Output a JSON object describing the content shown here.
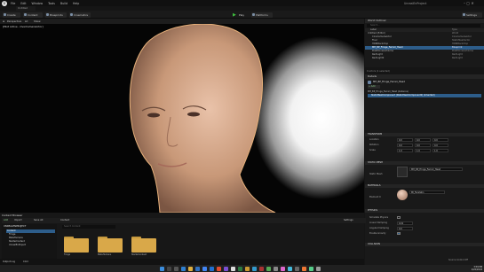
{
  "menu": {
    "items": [
      "File",
      "Edit",
      "Window",
      "Tools",
      "Build",
      "Help"
    ],
    "project": "UnrealEnProject"
  },
  "doc_tab": "Untitled",
  "toolbar": {
    "create": "Create",
    "content": "Content",
    "blueprint": "Blueprints",
    "cinematics": "Cinematics",
    "play": "Play",
    "platforms": "Platforms",
    "settings": "Settings"
  },
  "viewport": {
    "perspective": "Perspective",
    "lit": "Lit",
    "show": "Show",
    "pilot": "[Pilot Active - OverCameraActor]"
  },
  "outliner": {
    "title": "World Outliner",
    "search_placeholder": "Search...",
    "col_label": "Label",
    "col_type": "Type",
    "rows": [
      {
        "name": "Untitled (Editor)",
        "type": "World"
      },
      {
        "name": "CineCameraActor",
        "type": "CineCameraActor"
      },
      {
        "name": "Floor",
        "type": "StaticMeshActor"
      },
      {
        "name": "HDRIBackdrop",
        "type": "HDRIBackdrop"
      },
      {
        "name": "MH_BP_Fringe_Ferrari_Head",
        "type": "Blueprint"
      },
      {
        "name": "PostProcessVolume",
        "type": "PostProcessVolume"
      },
      {
        "name": "RectLight",
        "type": "RectLight"
      },
      {
        "name": "RectLight2",
        "type": "RectLight"
      }
    ],
    "status": "9 actors (1 selected)"
  },
  "details": {
    "title": "Details",
    "actor": "MH_BP_Fringe_Ferrari_Head",
    "add_button": "+ Add",
    "component_root": "MH_BP_Fringe_Ferrari_Head (Instance)",
    "component_child": "StaticMeshComponent (StaticMeshComponent0) (Inherited)",
    "transform": {
      "section": "TRANSFORM",
      "location_label": "Location",
      "rotation_label": "Rotation",
      "scale_label": "Scale",
      "location": [
        "0.0",
        "0.0",
        "0.0"
      ],
      "rotation": [
        "0.0",
        "0.0",
        "0.0"
      ],
      "scale": [
        "1.0",
        "1.0",
        "1.0"
      ]
    },
    "static_mesh": {
      "section": "STATIC MESH",
      "label": "Static Mesh",
      "value": "MH_BP_Fringe_Ferrari_Head"
    },
    "materials": {
      "section": "MATERIALS",
      "label": "Element 0",
      "value": "MI_FaceSkin"
    },
    "physics": {
      "section": "PHYSICS"
    },
    "lighting_fields": [
      {
        "label": "Simulate Physics",
        "value": ""
      },
      {
        "label": "Linear Damping",
        "value": "0.01"
      },
      {
        "label": "Angular Damping",
        "value": "0.0"
      },
      {
        "label": "Enable Gravity",
        "value": ""
      }
    ],
    "collision": {
      "section": "COLLISION"
    }
  },
  "content_browser": {
    "tab": "Content Browser",
    "add": "Add",
    "import": "Import",
    "save_all": "Save All",
    "path": "Content",
    "settings": "Settings",
    "tree_root": "UNREALENPROJECT",
    "tree": [
      "Content",
      "Fringe",
      "MetaHumans",
      "StarterContent",
      "UnrealEnProject"
    ],
    "search_placeholder": "Search Content",
    "folders": [
      "Fringe",
      "MetaHumans",
      "StarterContent"
    ],
    "collections": "COLLECTIONS",
    "items_count": "3 items"
  },
  "status_bar": {
    "output": "Output Log",
    "cmd": "Cmd",
    "source": "Source Control Off"
  },
  "taskbar": {
    "time": "3:59 PM",
    "date": "2/20/2024"
  },
  "colors": {
    "selection": "#2d5d8a",
    "folder": "#d9a849",
    "accent": "#3fbf3f"
  }
}
